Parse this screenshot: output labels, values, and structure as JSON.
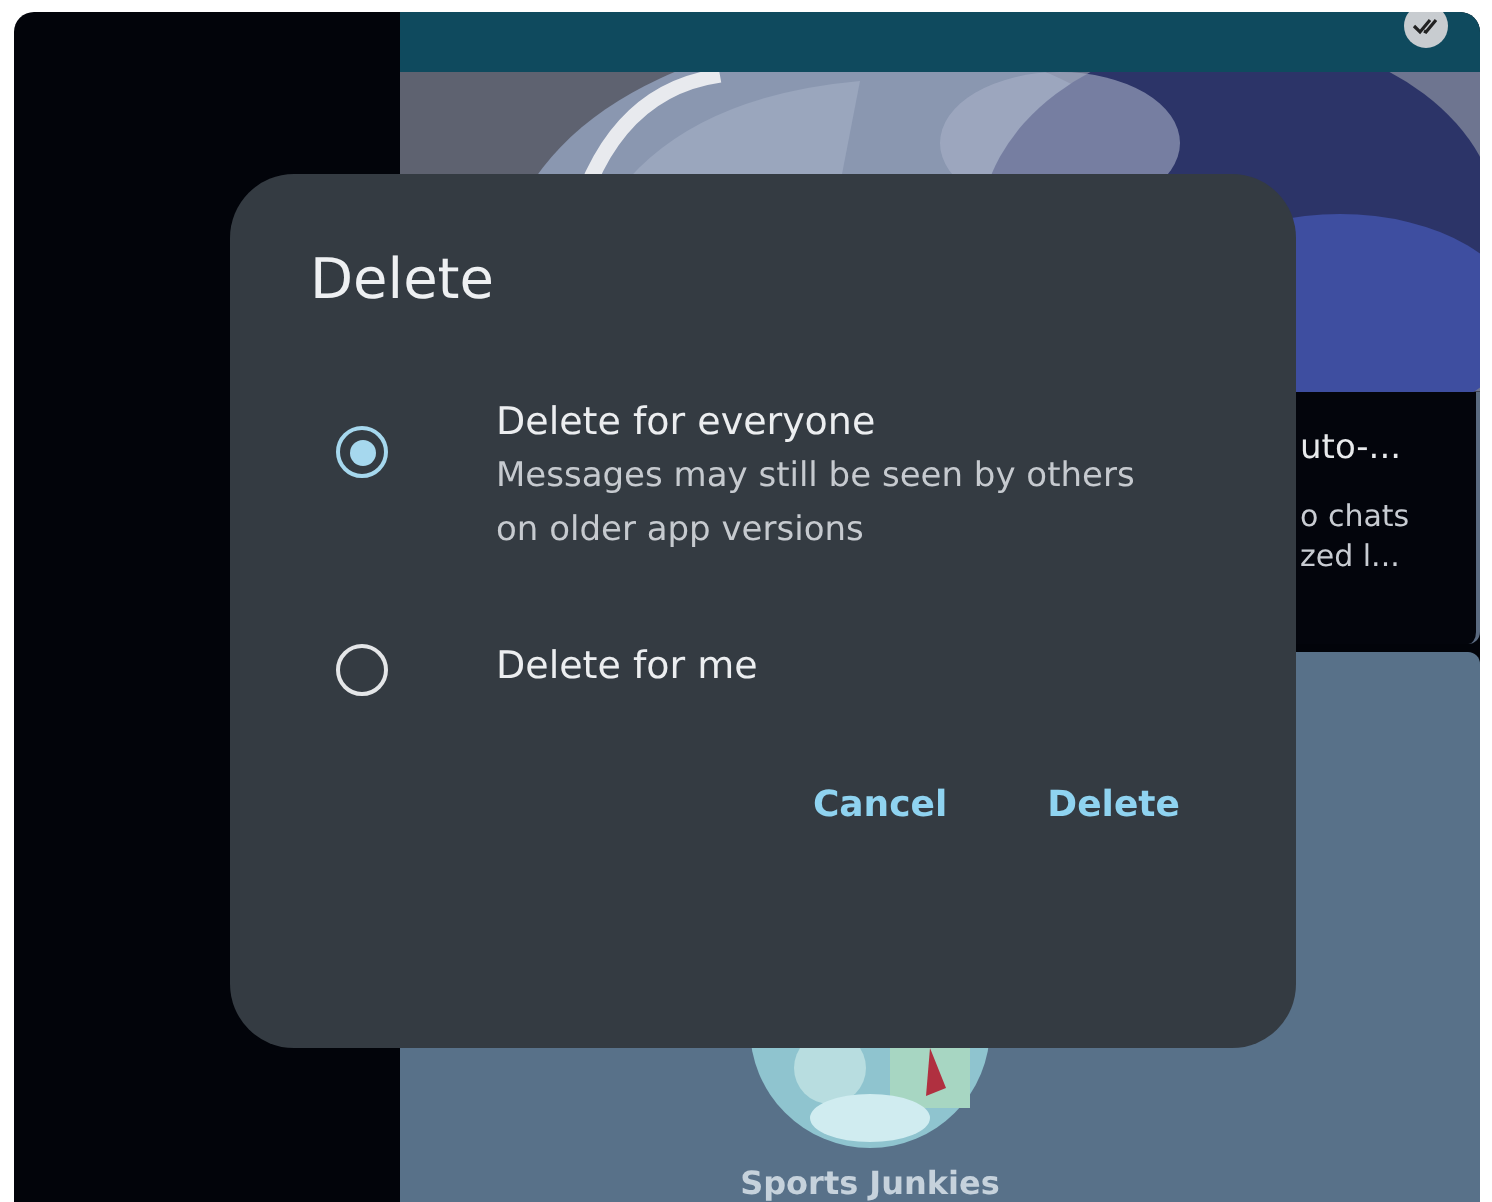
{
  "background": {
    "chat_card": {
      "lines": [
        "uto-...",
        "o chats",
        "zed l..."
      ]
    },
    "group": {
      "name": "Sports Junkies"
    }
  },
  "dialog": {
    "title": "Delete",
    "options": [
      {
        "label": "Delete for everyone",
        "description": "Messages may still be seen by others on older app versions",
        "selected": true
      },
      {
        "label": "Delete for me",
        "selected": false
      }
    ],
    "buttons": [
      {
        "label": "Cancel"
      },
      {
        "label": "Delete"
      }
    ]
  }
}
